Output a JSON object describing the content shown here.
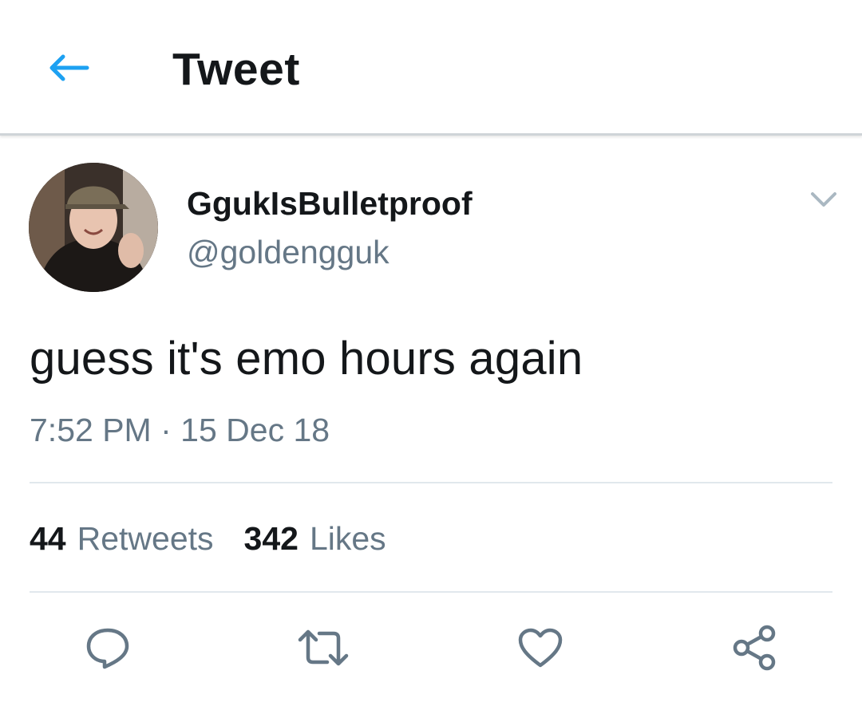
{
  "header": {
    "title": "Tweet",
    "back_icon": "arrow-left-icon"
  },
  "colors": {
    "accent": "#1da1f2",
    "secondary_text": "#657786",
    "primary_text": "#14171a",
    "divider": "#e1e8ed"
  },
  "tweet": {
    "author": {
      "display_name": "GgukIsBulletproof",
      "handle": "@goldengguk"
    },
    "text": "guess it's emo hours again",
    "time": "7:52 PM",
    "separator": "·",
    "date": "15 Dec 18",
    "stats": {
      "retweets_count": "44",
      "retweets_label": "Retweets",
      "likes_count": "342",
      "likes_label": "Likes"
    }
  },
  "actions": [
    {
      "name": "reply",
      "icon": "reply-icon"
    },
    {
      "name": "retweet",
      "icon": "retweet-icon"
    },
    {
      "name": "like",
      "icon": "heart-icon"
    },
    {
      "name": "share",
      "icon": "share-icon"
    }
  ]
}
